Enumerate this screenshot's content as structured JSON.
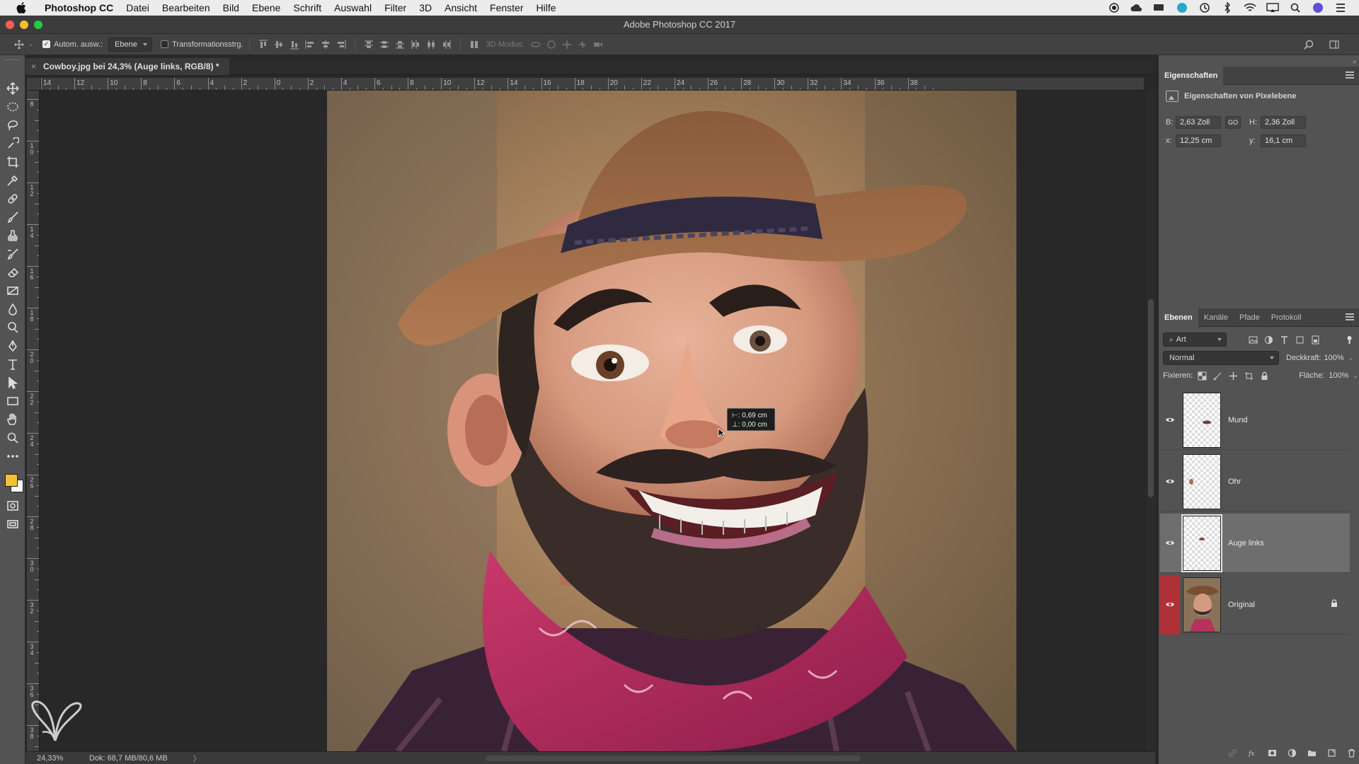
{
  "menubar": {
    "app_name": "Photoshop CC",
    "items": [
      "Datei",
      "Bearbeiten",
      "Bild",
      "Ebene",
      "Schrift",
      "Auswahl",
      "Filter",
      "3D",
      "Ansicht",
      "Fenster",
      "Hilfe"
    ],
    "status_icons": [
      "record-icon",
      "creative-cloud-icon",
      "display-icon",
      "app-icon",
      "time-machine-icon",
      "bluetooth-icon",
      "wifi-icon",
      "airplay-icon",
      "spotlight-icon",
      "siri-icon",
      "notification-icon"
    ]
  },
  "window": {
    "title": "Adobe Photoshop CC 2017"
  },
  "options_bar": {
    "auto_select_label": "Autom. ausw.:",
    "auto_select_checked": true,
    "auto_select_target": "Ebene",
    "transform_label": "Transformationsstrg.",
    "transform_checked": false,
    "mode_3d_label": "3D-Modus:"
  },
  "document": {
    "tab_title": "Cowboy.jpg bei 24,3% (Auge links, RGB/8) *",
    "close_symbol": "×"
  },
  "ruler": {
    "h_labels": [
      "14",
      "12",
      "10",
      "8",
      "6",
      "4",
      "2",
      "0",
      "2",
      "4",
      "6",
      "8",
      "10",
      "12",
      "14",
      "16",
      "18",
      "20",
      "22",
      "24",
      "26",
      "28",
      "30",
      "32",
      "34",
      "36",
      "38"
    ],
    "v_labels": [
      "8",
      "1\n0",
      "1\n2",
      "1\n4",
      "1\n6",
      "1\n8",
      "2\n0",
      "2\n2",
      "2\n4",
      "2\n6",
      "2\n8",
      "3\n0",
      "3\n2",
      "3\n4",
      "3\n6",
      "3\n8"
    ]
  },
  "tooltip": {
    "line1": "⊢: 0,69 cm",
    "line2": "⊥: 0,00 cm"
  },
  "status_bar": {
    "zoom": "24,33%",
    "doc_info": "Dok: 68,7 MB/80,6 MB",
    "arrow": "〉"
  },
  "properties": {
    "panel_title": "Eigenschaften",
    "subtitle": "Eigenschaften von Pixelebene",
    "b_label": "B:",
    "b_value": "2,63 Zoll",
    "h_label": "H:",
    "h_value": "2,36 Zoll",
    "x_label": "x:",
    "x_value": "12,25 cm",
    "y_label": "y:",
    "y_value": "16,1 cm",
    "link_icon": "GO"
  },
  "layers_panel": {
    "tabs": [
      "Ebenen",
      "Kanäle",
      "Pfade",
      "Protokoll"
    ],
    "active_tab": 0,
    "filter_label": "Art",
    "blend_mode": "Normal",
    "opacity_label": "Deckkraft:",
    "opacity_value": "100%",
    "lock_label": "Fixieren:",
    "fill_label": "Fläche:",
    "fill_value": "100%",
    "layers": [
      {
        "name": "Mund",
        "visible": true,
        "selected": false,
        "locked": false
      },
      {
        "name": "Ohr",
        "visible": true,
        "selected": false,
        "locked": false
      },
      {
        "name": "Auge links",
        "visible": true,
        "selected": true,
        "locked": false
      },
      {
        "name": "Original",
        "visible": true,
        "selected": false,
        "locked": true
      }
    ]
  },
  "colors": {
    "foreground": "#f2c230",
    "background": "#ffffff",
    "accent_red": "#b03038"
  }
}
